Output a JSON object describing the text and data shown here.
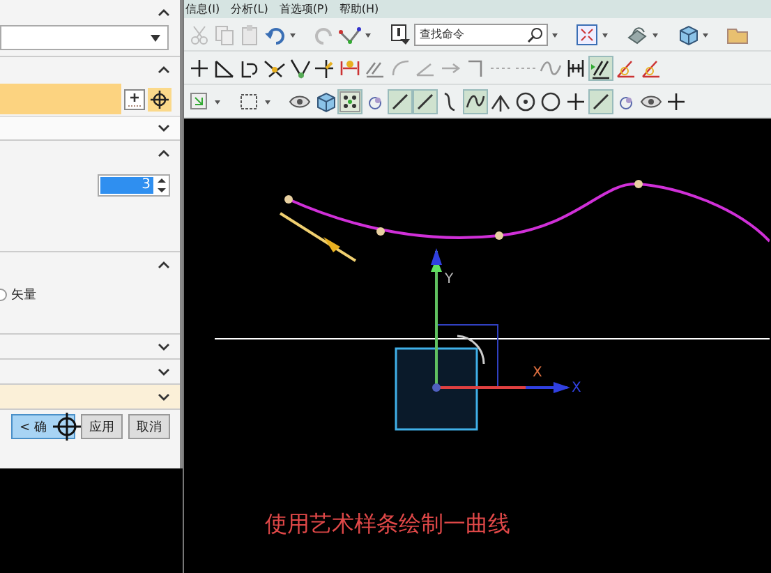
{
  "menu": [
    {
      "label": "信息(I)"
    },
    {
      "label": "分析(L)"
    },
    {
      "label": "首选项(P)"
    },
    {
      "label": "帮助(H)"
    }
  ],
  "search": {
    "placeholder": "查找命令"
  },
  "dialog": {
    "sections": [
      {
        "kind": "dropdown",
        "expanded": true
      },
      {
        "kind": "selection",
        "expanded": true
      },
      {
        "kind": "degree",
        "expanded": true,
        "value": "3"
      },
      {
        "kind": "radio",
        "expanded": true,
        "option": {
          "label": "矢量",
          "selected": false
        }
      },
      {
        "kind": "collapsed",
        "expanded": false
      },
      {
        "kind": "collapsed",
        "expanded": false
      },
      {
        "kind": "collapsed",
        "expanded": false
      }
    ],
    "buttons": [
      {
        "label": "< 确",
        "kind": "primary"
      },
      {
        "label": "应用",
        "kind": "normal"
      },
      {
        "label": "取消",
        "kind": "normal"
      }
    ]
  },
  "viewport": {
    "axis_labels": [
      {
        "label": "Y",
        "kind": "y"
      },
      {
        "label": "X",
        "kind": "x-handle"
      },
      {
        "label": "X",
        "kind": "x"
      }
    ],
    "caption": "使用艺术样条绘制一曲线"
  }
}
